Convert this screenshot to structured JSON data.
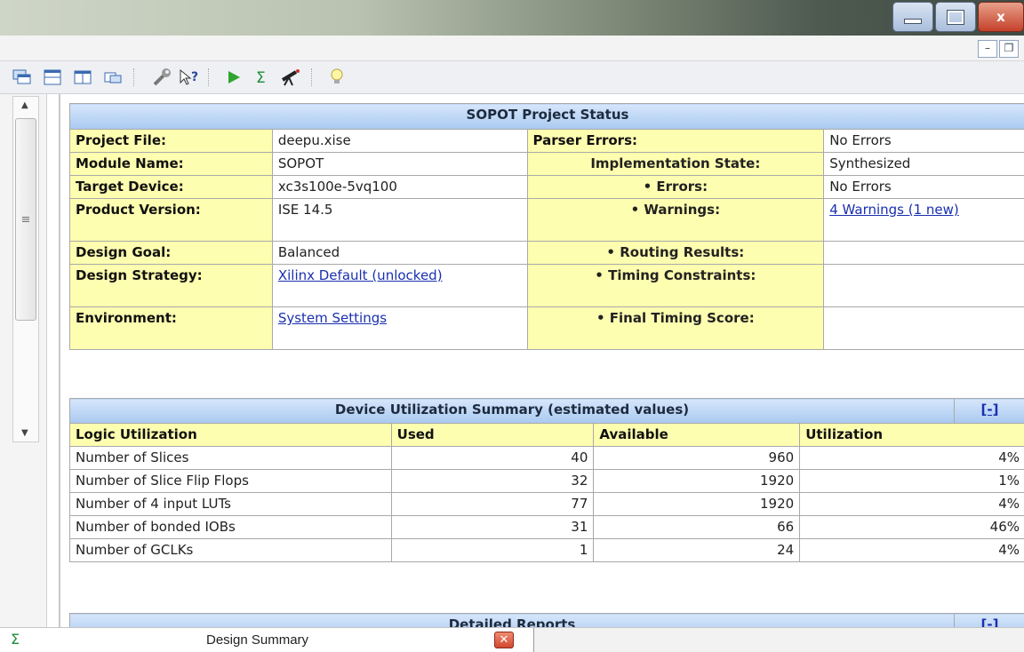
{
  "window": {
    "close_glyph": "x"
  },
  "toolbar": {
    "icons": [
      "cascade-windows-icon",
      "tile-horizontal-icon",
      "tile-vertical-icon",
      "float-window-icon",
      "wrench-icon",
      "context-help-icon",
      "run-icon",
      "sigma-icon",
      "telescope-icon",
      "lightbulb-icon"
    ]
  },
  "project_status": {
    "title": "SOPOT Project Status",
    "rows": [
      {
        "l1": "Project File:",
        "v1": "deepu.xise",
        "l2": "Parser Errors:",
        "v2": "No Errors"
      },
      {
        "l1": "Module Name:",
        "v1": "SOPOT",
        "l2": "Implementation State:",
        "v2": "Synthesized"
      },
      {
        "l1": "Target Device:",
        "v1": "xc3s100e-5vq100",
        "l2": "• Errors:",
        "v2": "No Errors"
      },
      {
        "l1": "Product Version:",
        "v1": "ISE 14.5",
        "l2": "• Warnings:",
        "v2": "4 Warnings (1 new)"
      },
      {
        "l1": "Design Goal:",
        "v1": "Balanced",
        "l2": "• Routing Results:",
        "v2": ""
      },
      {
        "l1": "Design Strategy:",
        "v1": "Xilinx Default (unlocked)",
        "l2": "• Timing Constraints:",
        "v2": ""
      },
      {
        "l1": "Environment:",
        "v1": "System Settings",
        "l2": "• Final Timing Score:",
        "v2": ""
      }
    ]
  },
  "utilization": {
    "title": "Device Utilization Summary (estimated values)",
    "collapse": "[-]",
    "columns": [
      "Logic Utilization",
      "Used",
      "Available",
      "Utilization"
    ],
    "rows": [
      [
        "Number of Slices",
        "40",
        "960",
        "4%"
      ],
      [
        "Number of Slice Flip Flops",
        "32",
        "1920",
        "1%"
      ],
      [
        "Number of 4 input LUTs",
        "77",
        "1920",
        "4%"
      ],
      [
        "Number of bonded IOBs",
        "31",
        "66",
        "46%"
      ],
      [
        "Number of GCLKs",
        "1",
        "24",
        "4%"
      ]
    ]
  },
  "detailed_reports": {
    "title": "Detailed Reports",
    "collapse": "[-]"
  },
  "tabs": {
    "label": "Design Summary",
    "icon": "sigma-icon"
  }
}
